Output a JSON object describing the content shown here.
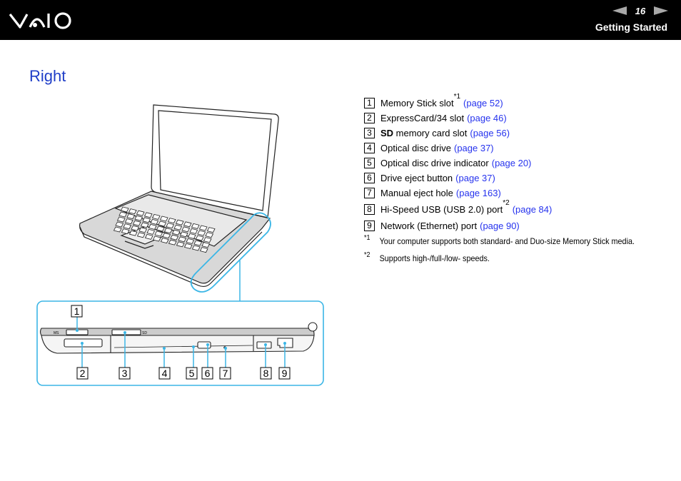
{
  "header": {
    "logo": "VAIO",
    "page_number": "16",
    "section": "Getting Started",
    "prev_icon": "prev-page-arrow-icon",
    "next_icon": "next-page-arrow-icon"
  },
  "title": "Right",
  "items": [
    {
      "num": "1",
      "bold": "",
      "text": "Memory Stick slot",
      "sup": "*1",
      "link": "(page 52)"
    },
    {
      "num": "2",
      "bold": "",
      "text": "ExpressCard/34 slot",
      "sup": "",
      "link": "(page 46)"
    },
    {
      "num": "3",
      "bold": "SD",
      "text": " memory card slot",
      "sup": "",
      "link": "(page 56)"
    },
    {
      "num": "4",
      "bold": "",
      "text": "Optical disc drive",
      "sup": "",
      "link": "(page 37)"
    },
    {
      "num": "5",
      "bold": "",
      "text": "Optical disc drive indicator",
      "sup": "",
      "link": "(page 20)"
    },
    {
      "num": "6",
      "bold": "",
      "text": "Drive eject button",
      "sup": "",
      "link": "(page 37)"
    },
    {
      "num": "7",
      "bold": "",
      "text": "Manual eject hole",
      "sup": "",
      "link": "(page 163)"
    },
    {
      "num": "8",
      "bold": "",
      "text": "Hi-Speed USB (USB 2.0) port",
      "sup": "*2",
      "link": "(page 84)"
    },
    {
      "num": "9",
      "bold": "",
      "text": "Network (Ethernet) port",
      "sup": "",
      "link": "(page 90)"
    }
  ],
  "notes": [
    {
      "mark": "*1",
      "text": "Your computer supports both standard- and Duo-size Memory Stick media."
    },
    {
      "mark": "*2",
      "text": "Supports high-/full-/low- speeds."
    }
  ],
  "figure": {
    "callouts": [
      "1",
      "2",
      "3",
      "4",
      "5",
      "6",
      "7",
      "8",
      "9"
    ],
    "port_labels": {
      "ms": "MS",
      "sd": "SD"
    },
    "accent_color": "#3bb6e6"
  }
}
